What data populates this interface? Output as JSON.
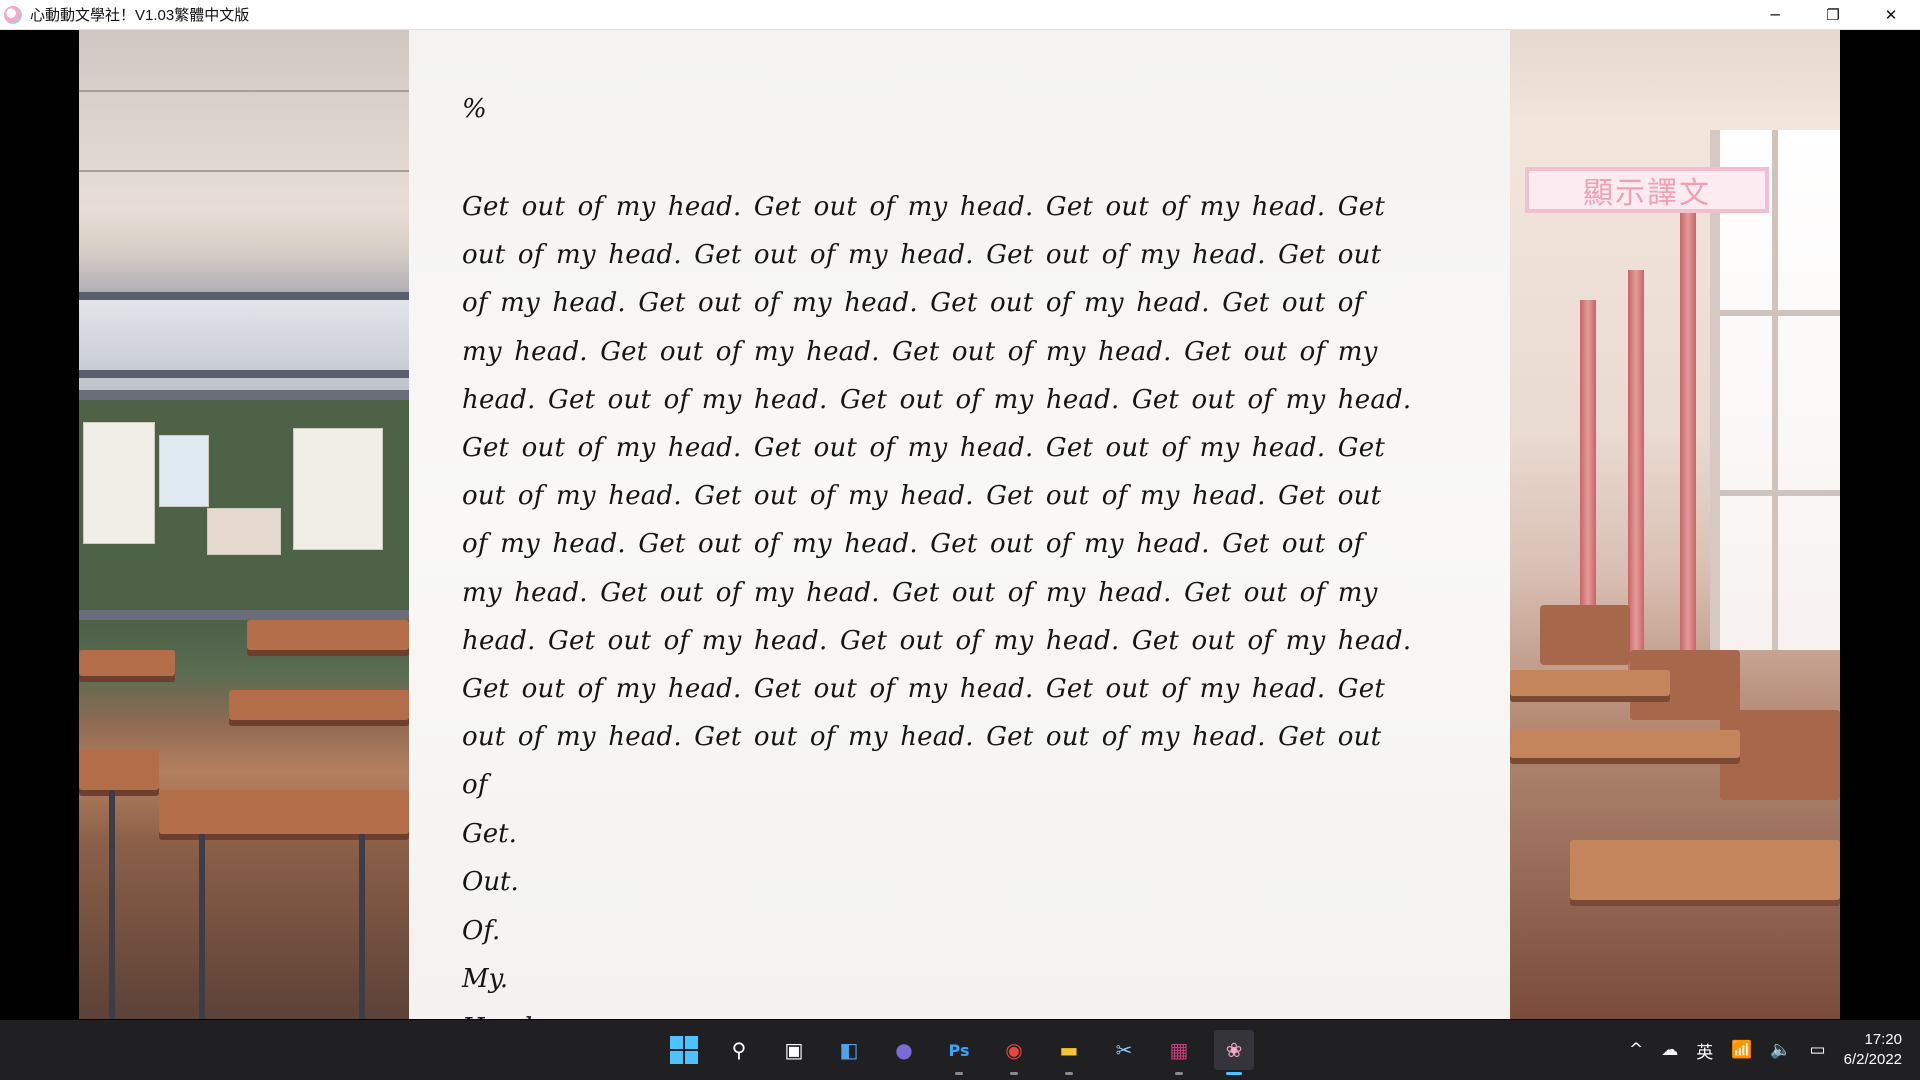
{
  "window": {
    "title": "心動動文學社！V1.03繁體中文版",
    "controls": {
      "minimize": "─",
      "restore": "❐",
      "close": "✕"
    }
  },
  "poem": {
    "title": "%",
    "body": "Get out of my head. Get out of my head. Get out of my head. Get out of my head. Get out of my head. Get out of my head. Get out of my head. Get out of my head. Get out of my head. Get out of my head. Get out of my head. Get out of my head. Get out of my head. Get out of my head. Get out of my head. Get out of my head. Get out of my head. Get out of my head. Get out of my head. Get out of my head. Get out of my head. Get out of my head. Get out of my head. Get out of my head. Get out of my head. Get out of my head. Get out of my head. Get out of my head. Get out of my head. Get out of my head. Get out of my head. Get out of my head. Get out of my head. Get out of my head. Get out of my head. Get out of my head. Get out of my head. Get out of my head. Get out of",
    "lines": [
      "Get.",
      "Out.",
      "Of.",
      "My.",
      "Head."
    ]
  },
  "translate_button": {
    "label": "顯示譯文"
  },
  "scrollbar": {
    "position": 0
  },
  "taskbar": {
    "apps": [
      {
        "name": "start",
        "icon": "windows-start-icon"
      },
      {
        "name": "search",
        "icon": "search-icon",
        "glyph": "⚲"
      },
      {
        "name": "task-view",
        "icon": "task-view-icon",
        "glyph": "▣"
      },
      {
        "name": "widgets",
        "icon": "widgets-icon",
        "glyph": "◧"
      },
      {
        "name": "teams-chat",
        "icon": "chat-icon",
        "glyph": "●"
      },
      {
        "name": "photoshop",
        "icon": "photoshop-icon",
        "glyph": "Ps"
      },
      {
        "name": "chrome",
        "icon": "chrome-icon",
        "glyph": "◉"
      },
      {
        "name": "file-explorer",
        "icon": "folder-icon",
        "glyph": "▬"
      },
      {
        "name": "snipping-tool",
        "icon": "snipping-tool-icon",
        "glyph": "✂"
      },
      {
        "name": "winrar",
        "icon": "archive-icon",
        "glyph": "▦"
      },
      {
        "name": "ddlc",
        "icon": "game-icon",
        "glyph": "❀"
      }
    ],
    "tray": {
      "chevron": "^",
      "ime": "英",
      "wifi": "wifi-icon",
      "volume": "volume-icon",
      "battery": "battery-icon"
    },
    "clock": {
      "time": "17:20",
      "date": "6/2/2022"
    }
  },
  "colors": {
    "accent": "#4cc2ff",
    "button_text": "#f19fb5",
    "button_border": "#f3bed0",
    "taskbar_bg": "#202023"
  }
}
